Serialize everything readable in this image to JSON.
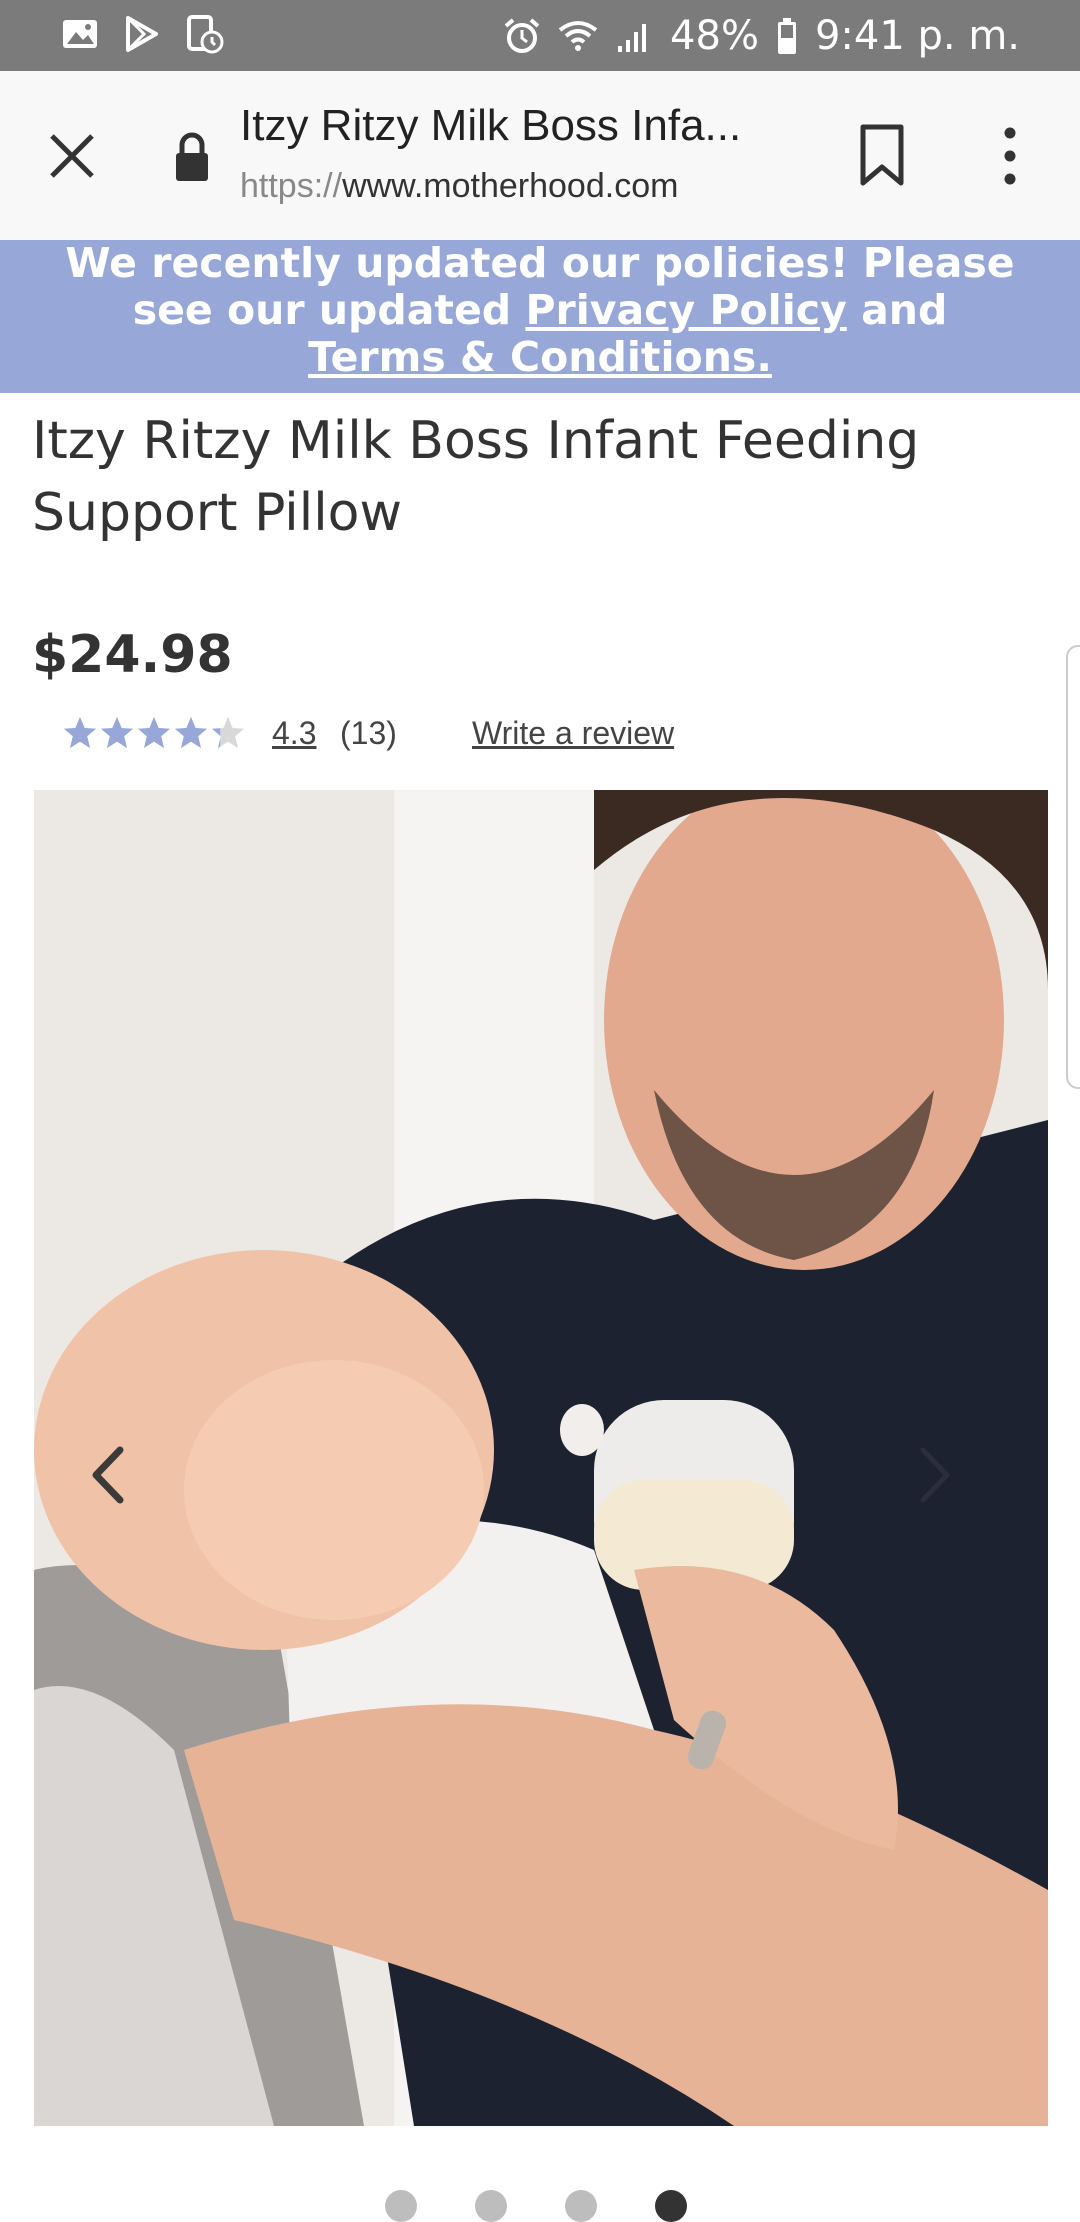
{
  "status_bar": {
    "battery": "48%",
    "time": "9:41 p. m.",
    "icons": [
      "gallery-icon",
      "play-store-icon",
      "screen-record-icon",
      "alarm-icon",
      "wifi-icon",
      "signal-icon",
      "battery-icon"
    ]
  },
  "browser": {
    "title": "Itzy Ritzy Milk Boss Infa...",
    "url_scheme": "https://",
    "url_host": "www.motherhood.com",
    "icons": [
      "close-icon",
      "lock-icon",
      "bookmark-icon",
      "more-vert-icon"
    ]
  },
  "banner": {
    "line1": "We recently updated our policies! Please",
    "line2_prefix": "see our updated ",
    "privacy_link": "Privacy Policy",
    "line2_suffix": " and",
    "terms_link": "Terms & Conditions",
    "terms_suffix": ".",
    "background": "#97a8d8"
  },
  "product": {
    "title": "Itzy Ritzy Milk Boss Infant Feeding Support Pillow",
    "price": "$24.98",
    "rating": {
      "value": "4.3",
      "count": "(13)",
      "stars": 4.3,
      "max": 5,
      "star_color": "#97a8d8"
    },
    "write_review": "Write a review",
    "image": {
      "alt": "product photo",
      "current_slide": 4,
      "slides": 4
    }
  }
}
